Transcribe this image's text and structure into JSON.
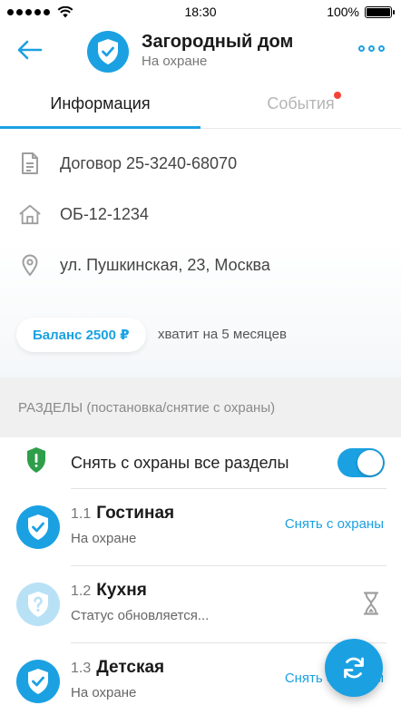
{
  "status_bar": {
    "time": "18:30",
    "battery": "100%"
  },
  "header": {
    "title": "Загородный дом",
    "subtitle": "На охране"
  },
  "tabs": [
    {
      "label": "Информация",
      "active": true
    },
    {
      "label": "События",
      "active": false,
      "has_notification": true
    }
  ],
  "info": {
    "contract": "Договор 25-3240-68070",
    "object_id": "ОБ-12-1234",
    "address": "ул. Пушкинская, 23, Москва"
  },
  "balance": {
    "label": "Баланс 2500 ₽",
    "note": "хватит на 5 месяцев"
  },
  "sections": {
    "header": "РАЗДЕЛЫ (постановка/снятие с охраны)",
    "disarm_all_label": "Снять с охраны все разделы",
    "disarm_all_on": true,
    "items": [
      {
        "number": "1.1",
        "name": "Гостиная",
        "state": "На охране",
        "action": "Снять с охраны",
        "status": "armed"
      },
      {
        "number": "1.2",
        "name": "Кухня",
        "state": "Статус обновляется...",
        "action": "",
        "status": "pending"
      },
      {
        "number": "1.3",
        "name": "Детская",
        "state": "На охране",
        "action": "Снять с охраны",
        "status": "armed"
      }
    ]
  },
  "colors": {
    "accent": "#1ba1e2",
    "alert_dot": "#f44336",
    "shield_green": "#2e9e4a"
  }
}
